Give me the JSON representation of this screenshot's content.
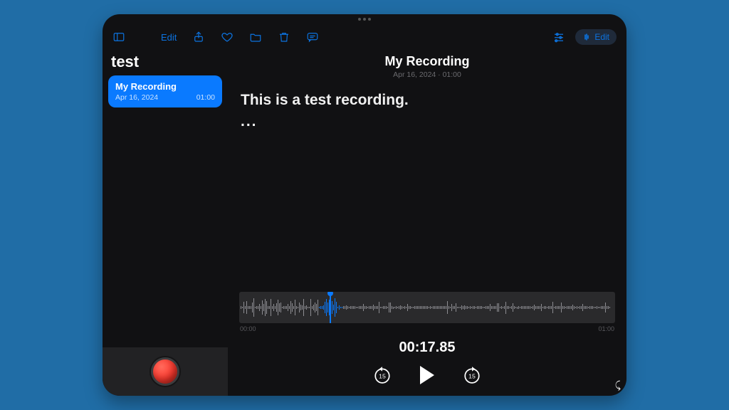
{
  "toolbar": {
    "edit_left_label": "Edit",
    "edit_pill_label": "Edit"
  },
  "sidebar": {
    "title": "test",
    "items": [
      {
        "name": "My Recording",
        "date": "Apr 16, 2024",
        "duration": "01:00"
      }
    ]
  },
  "main": {
    "title": "My Recording",
    "subtitle": "Apr 16, 2024 · 01:00",
    "transcript_line": "This is a test recording.",
    "transcript_dots": "...",
    "waveform": {
      "start_label": "00:00",
      "end_label": "01:00",
      "playhead_percent": 24
    },
    "timecode": "00:17.85",
    "skip_seconds": "15"
  }
}
